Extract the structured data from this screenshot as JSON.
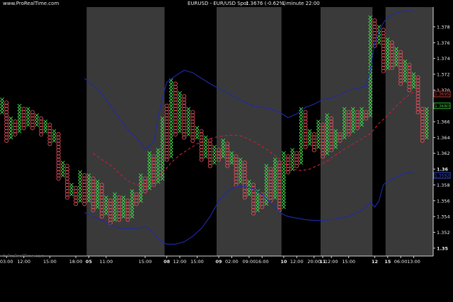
{
  "header": {
    "site": "www.ProRealTime.com",
    "instrument": "EURUSD - EUR/USD Spot",
    "price": "1.3676 (-0.62%)",
    "timeframe": "1 minute 22:00"
  },
  "watermark": "© ProRealTime.com",
  "chart_data": {
    "type": "point-and-figure",
    "ylim": [
      1.349,
      1.3805
    ],
    "y_ticks": [
      "1.35",
      "1.352",
      "1.354",
      "1.356",
      "1.358",
      "1.36",
      "1.362",
      "1.364",
      "1.366",
      "1.368",
      "1.370",
      "1.372",
      "1.374",
      "1.376",
      "1.378"
    ],
    "y_tick_values": [
      1.35,
      1.352,
      1.354,
      1.356,
      1.358,
      1.36,
      1.362,
      1.364,
      1.366,
      1.368,
      1.37,
      1.372,
      1.374,
      1.376,
      1.378
    ],
    "box_size": 0.0004,
    "n_columns": 100,
    "x_labels": [
      {
        "text": "03:00",
        "col": 1,
        "bold": false
      },
      {
        "text": "12:00",
        "col": 5,
        "bold": false
      },
      {
        "text": "15:00",
        "col": 11,
        "bold": false
      },
      {
        "text": "18:00",
        "col": 17,
        "bold": false
      },
      {
        "text": "05",
        "col": 20,
        "bold": true
      },
      {
        "text": "11:00",
        "col": 24,
        "bold": false
      },
      {
        "text": "15:00",
        "col": 33,
        "bold": false
      },
      {
        "text": "08",
        "col": 38,
        "bold": true
      },
      {
        "text": "12:00",
        "col": 41,
        "bold": false
      },
      {
        "text": "15:00",
        "col": 45,
        "bold": false
      },
      {
        "text": "09",
        "col": 50,
        "bold": true
      },
      {
        "text": "02:00",
        "col": 53,
        "bold": false
      },
      {
        "text": "09:00",
        "col": 57,
        "bold": false
      },
      {
        "text": "16:00",
        "col": 60,
        "bold": false
      },
      {
        "text": "10",
        "col": 65,
        "bold": true
      },
      {
        "text": "12:00",
        "col": 68,
        "bold": false
      },
      {
        "text": "20:00",
        "col": 72,
        "bold": false
      },
      {
        "text": "11",
        "col": 74,
        "bold": true
      },
      {
        "text": "12:00",
        "col": 76,
        "bold": false
      },
      {
        "text": "15:00",
        "col": 80,
        "bold": false
      },
      {
        "text": "12",
        "col": 86,
        "bold": true
      },
      {
        "text": "15",
        "col": 89,
        "bold": true
      },
      {
        "text": "06:00",
        "col": 92,
        "bold": false
      },
      {
        "text": "13:00",
        "col": 95,
        "bold": false
      }
    ],
    "bands": [
      {
        "from": 0,
        "to": 20,
        "shade": "dark"
      },
      {
        "from": 20,
        "to": 38,
        "shade": "light"
      },
      {
        "from": 38,
        "to": 50,
        "shade": "dark"
      },
      {
        "from": 50,
        "to": 65,
        "shade": "light"
      },
      {
        "from": 65,
        "to": 74,
        "shade": "dark"
      },
      {
        "from": 74,
        "to": 86,
        "shade": "light"
      },
      {
        "from": 86,
        "to": 89,
        "shade": "dark"
      },
      {
        "from": 89,
        "to": 100,
        "shade": "light"
      }
    ],
    "columns": [
      {
        "t": "X",
        "low": 1.3672,
        "high": 1.3688
      },
      {
        "t": "O",
        "low": 1.3636,
        "high": 1.3684
      },
      {
        "t": "X",
        "low": 1.364,
        "high": 1.3664
      },
      {
        "t": "O",
        "low": 1.3644,
        "high": 1.366
      },
      {
        "t": "X",
        "low": 1.3648,
        "high": 1.368
      },
      {
        "t": "O",
        "low": 1.3652,
        "high": 1.3676
      },
      {
        "t": "X",
        "low": 1.3656,
        "high": 1.3676
      },
      {
        "t": "O",
        "low": 1.3652,
        "high": 1.3672
      },
      {
        "t": "X",
        "low": 1.3656,
        "high": 1.3668
      },
      {
        "t": "O",
        "low": 1.3644,
        "high": 1.3664
      },
      {
        "t": "X",
        "low": 1.3648,
        "high": 1.366
      },
      {
        "t": "O",
        "low": 1.3632,
        "high": 1.3656
      },
      {
        "t": "X",
        "low": 1.3636,
        "high": 1.3648
      },
      {
        "t": "O",
        "low": 1.3588,
        "high": 1.3644
      },
      {
        "t": "X",
        "low": 1.3592,
        "high": 1.3608
      },
      {
        "t": "O",
        "low": 1.3564,
        "high": 1.3604
      },
      {
        "t": "X",
        "low": 1.3568,
        "high": 1.358
      },
      {
        "t": "O",
        "low": 1.3556,
        "high": 1.3576
      },
      {
        "t": "X",
        "low": 1.356,
        "high": 1.3596
      },
      {
        "t": "O",
        "low": 1.3556,
        "high": 1.3592
      },
      {
        "t": "X",
        "low": 1.356,
        "high": 1.3592
      },
      {
        "t": "O",
        "low": 1.3548,
        "high": 1.3588
      },
      {
        "t": "X",
        "low": 1.3552,
        "high": 1.3584
      },
      {
        "t": "O",
        "low": 1.354,
        "high": 1.358
      },
      {
        "t": "X",
        "low": 1.3544,
        "high": 1.3564
      },
      {
        "t": "O",
        "low": 1.3532,
        "high": 1.356
      },
      {
        "t": "X",
        "low": 1.3536,
        "high": 1.3568
      },
      {
        "t": "O",
        "low": 1.3536,
        "high": 1.3564
      },
      {
        "t": "X",
        "low": 1.354,
        "high": 1.3564
      },
      {
        "t": "O",
        "low": 1.3536,
        "high": 1.356
      },
      {
        "t": "X",
        "low": 1.354,
        "high": 1.3572
      },
      {
        "t": "O",
        "low": 1.3556,
        "high": 1.3568
      },
      {
        "t": "X",
        "low": 1.356,
        "high": 1.3592
      },
      {
        "t": "O",
        "low": 1.3572,
        "high": 1.3588
      },
      {
        "t": "X",
        "low": 1.3576,
        "high": 1.362
      },
      {
        "t": "O",
        "low": 1.358,
        "high": 1.3616
      },
      {
        "t": "X",
        "low": 1.3584,
        "high": 1.3624
      },
      {
        "t": "X",
        "low": 1.3588,
        "high": 1.3664
      },
      {
        "t": "O",
        "low": 1.3612,
        "high": 1.368
      },
      {
        "t": "X",
        "low": 1.3616,
        "high": 1.3712
      },
      {
        "t": "O",
        "low": 1.3644,
        "high": 1.3708
      },
      {
        "t": "X",
        "low": 1.3648,
        "high": 1.3696
      },
      {
        "t": "O",
        "low": 1.364,
        "high": 1.3692
      },
      {
        "t": "X",
        "low": 1.3644,
        "high": 1.3676
      },
      {
        "t": "O",
        "low": 1.3636,
        "high": 1.3672
      },
      {
        "t": "X",
        "low": 1.364,
        "high": 1.3652
      },
      {
        "t": "O",
        "low": 1.3612,
        "high": 1.3648
      },
      {
        "t": "X",
        "low": 1.3616,
        "high": 1.364
      },
      {
        "t": "O",
        "low": 1.3604,
        "high": 1.3636
      },
      {
        "t": "X",
        "low": 1.3608,
        "high": 1.3628
      },
      {
        "t": "O",
        "low": 1.3612,
        "high": 1.3624
      },
      {
        "t": "X",
        "low": 1.3616,
        "high": 1.3636
      },
      {
        "t": "O",
        "low": 1.3604,
        "high": 1.3632
      },
      {
        "t": "X",
        "low": 1.3608,
        "high": 1.362
      },
      {
        "t": "O",
        "low": 1.358,
        "high": 1.3616
      },
      {
        "t": "X",
        "low": 1.3584,
        "high": 1.3612
      },
      {
        "t": "O",
        "low": 1.3564,
        "high": 1.3608
      },
      {
        "t": "X",
        "low": 1.3568,
        "high": 1.3584
      },
      {
        "t": "O",
        "low": 1.3544,
        "high": 1.358
      },
      {
        "t": "X",
        "low": 1.3548,
        "high": 1.3572
      },
      {
        "t": "O",
        "low": 1.3552,
        "high": 1.3568
      },
      {
        "t": "X",
        "low": 1.3556,
        "high": 1.3604
      },
      {
        "t": "O",
        "low": 1.356,
        "high": 1.36
      },
      {
        "t": "X",
        "low": 1.3564,
        "high": 1.3612
      },
      {
        "t": "O",
        "low": 1.3548,
        "high": 1.3608
      },
      {
        "t": "X",
        "low": 1.3552,
        "high": 1.362
      },
      {
        "t": "O",
        "low": 1.3596,
        "high": 1.3616
      },
      {
        "t": "X",
        "low": 1.36,
        "high": 1.3624
      },
      {
        "t": "O",
        "low": 1.3604,
        "high": 1.362
      },
      {
        "t": "X",
        "low": 1.3608,
        "high": 1.3676
      },
      {
        "t": "O",
        "low": 1.3628,
        "high": 1.3672
      },
      {
        "t": "X",
        "low": 1.3632,
        "high": 1.3648
      },
      {
        "t": "O",
        "low": 1.3624,
        "high": 1.3644
      },
      {
        "t": "X",
        "low": 1.3628,
        "high": 1.366
      },
      {
        "t": "O",
        "low": 1.3616,
        "high": 1.3656
      },
      {
        "t": "X",
        "low": 1.362,
        "high": 1.3668
      },
      {
        "t": "O",
        "low": 1.3624,
        "high": 1.3664
      },
      {
        "t": "X",
        "low": 1.3628,
        "high": 1.3648
      },
      {
        "t": "O",
        "low": 1.3636,
        "high": 1.3644
      },
      {
        "t": "X",
        "low": 1.364,
        "high": 1.3676
      },
      {
        "t": "O",
        "low": 1.3644,
        "high": 1.3672
      },
      {
        "t": "X",
        "low": 1.3648,
        "high": 1.3676
      },
      {
        "t": "O",
        "low": 1.3652,
        "high": 1.3672
      },
      {
        "t": "X",
        "low": 1.3656,
        "high": 1.3676
      },
      {
        "t": "O",
        "low": 1.3664,
        "high": 1.3672
      },
      {
        "t": "X",
        "low": 1.3668,
        "high": 1.3792
      },
      {
        "t": "O",
        "low": 1.3756,
        "high": 1.3788
      },
      {
        "t": "X",
        "low": 1.376,
        "high": 1.378
      },
      {
        "t": "O",
        "low": 1.3724,
        "high": 1.3776
      },
      {
        "t": "X",
        "low": 1.3728,
        "high": 1.3764
      },
      {
        "t": "O",
        "low": 1.3728,
        "high": 1.376
      },
      {
        "t": "X",
        "low": 1.3732,
        "high": 1.3752
      },
      {
        "t": "O",
        "low": 1.3708,
        "high": 1.3748
      },
      {
        "t": "X",
        "low": 1.3712,
        "high": 1.3736
      },
      {
        "t": "O",
        "low": 1.37,
        "high": 1.3732
      },
      {
        "t": "X",
        "low": 1.3704,
        "high": 1.372
      },
      {
        "t": "O",
        "low": 1.3672,
        "high": 1.3716
      },
      {
        "t": "O",
        "low": 1.3636,
        "high": 1.3676
      },
      {
        "t": "X",
        "low": 1.364,
        "high": 1.3676
      }
    ],
    "series": [
      {
        "kind": "upper-band",
        "color": "#1f2aa6",
        "points": [
          [
            19,
            1.3715
          ],
          [
            21,
            1.3705
          ],
          [
            23,
            1.3695
          ],
          [
            25,
            1.368
          ],
          [
            27,
            1.3665
          ],
          [
            29,
            1.365
          ],
          [
            31,
            1.364
          ],
          [
            33,
            1.3625
          ],
          [
            35,
            1.3635
          ],
          [
            36,
            1.3665
          ],
          [
            37,
            1.369
          ],
          [
            38,
            1.371
          ],
          [
            40,
            1.3718
          ],
          [
            42,
            1.3725
          ],
          [
            44,
            1.3722
          ],
          [
            46,
            1.3715
          ],
          [
            48,
            1.3708
          ],
          [
            50,
            1.3702
          ],
          [
            52,
            1.3697
          ],
          [
            54,
            1.369
          ],
          [
            56,
            1.3685
          ],
          [
            58,
            1.368
          ],
          [
            60,
            1.3678
          ],
          [
            62,
            1.3676
          ],
          [
            64,
            1.3672
          ],
          [
            66,
            1.3665
          ],
          [
            68,
            1.367
          ],
          [
            70,
            1.3678
          ],
          [
            72,
            1.3682
          ],
          [
            74,
            1.3688
          ],
          [
            76,
            1.369
          ],
          [
            78,
            1.3694
          ],
          [
            80,
            1.37
          ],
          [
            82,
            1.3702
          ],
          [
            84,
            1.3705
          ],
          [
            85,
            1.3725
          ],
          [
            86,
            1.376
          ],
          [
            87,
            1.3775
          ],
          [
            88,
            1.3785
          ],
          [
            89,
            1.3792
          ],
          [
            91,
            1.3798
          ],
          [
            93,
            1.38
          ],
          [
            95,
            1.38
          ]
        ]
      },
      {
        "kind": "lower-band",
        "color": "#1f2aa6",
        "points": [
          [
            19,
            1.3545
          ],
          [
            21,
            1.354
          ],
          [
            23,
            1.3535
          ],
          [
            25,
            1.353
          ],
          [
            27,
            1.3525
          ],
          [
            29,
            1.3525
          ],
          [
            31,
            1.3525
          ],
          [
            33,
            1.3527
          ],
          [
            35,
            1.352
          ],
          [
            36,
            1.3512
          ],
          [
            37,
            1.3508
          ],
          [
            38,
            1.3505
          ],
          [
            40,
            1.3505
          ],
          [
            42,
            1.3508
          ],
          [
            44,
            1.3515
          ],
          [
            46,
            1.3525
          ],
          [
            48,
            1.354
          ],
          [
            50,
            1.356
          ],
          [
            52,
            1.3572
          ],
          [
            54,
            1.3578
          ],
          [
            56,
            1.3578
          ],
          [
            58,
            1.3575
          ],
          [
            60,
            1.3568
          ],
          [
            62,
            1.3557
          ],
          [
            64,
            1.3545
          ],
          [
            66,
            1.354
          ],
          [
            68,
            1.3538
          ],
          [
            70,
            1.3536
          ],
          [
            72,
            1.3535
          ],
          [
            74,
            1.3535
          ],
          [
            76,
            1.3536
          ],
          [
            78,
            1.3538
          ],
          [
            80,
            1.354
          ],
          [
            82,
            1.3545
          ],
          [
            84,
            1.3552
          ],
          [
            85,
            1.3558
          ],
          [
            86,
            1.3552
          ],
          [
            87,
            1.356
          ],
          [
            88,
            1.358
          ],
          [
            89,
            1.3585
          ],
          [
            91,
            1.359
          ],
          [
            93,
            1.3595
          ],
          [
            95,
            1.3595
          ]
        ]
      },
      {
        "kind": "moving-average",
        "color": "#c0203a",
        "dashed": true,
        "points": [
          [
            21,
            1.362
          ],
          [
            23,
            1.3612
          ],
          [
            25,
            1.3605
          ],
          [
            27,
            1.3595
          ],
          [
            29,
            1.3585
          ],
          [
            31,
            1.358
          ],
          [
            33,
            1.358
          ],
          [
            35,
            1.3585
          ],
          [
            37,
            1.3595
          ],
          [
            39,
            1.3608
          ],
          [
            41,
            1.3618
          ],
          [
            43,
            1.3625
          ],
          [
            45,
            1.3632
          ],
          [
            47,
            1.3637
          ],
          [
            49,
            1.364
          ],
          [
            51,
            1.3642
          ],
          [
            53,
            1.3643
          ],
          [
            55,
            1.3642
          ],
          [
            57,
            1.3638
          ],
          [
            59,
            1.3632
          ],
          [
            61,
            1.3625
          ],
          [
            63,
            1.3617
          ],
          [
            65,
            1.3608
          ],
          [
            67,
            1.36
          ],
          [
            69,
            1.3598
          ],
          [
            71,
            1.36
          ],
          [
            73,
            1.3605
          ],
          [
            75,
            1.361
          ],
          [
            77,
            1.3618
          ],
          [
            79,
            1.3625
          ],
          [
            81,
            1.3632
          ],
          [
            83,
            1.3638
          ],
          [
            85,
            1.3645
          ],
          [
            87,
            1.3658
          ],
          [
            89,
            1.3668
          ],
          [
            91,
            1.368
          ],
          [
            93,
            1.369
          ],
          [
            95,
            1.3698
          ]
        ]
      }
    ],
    "price_markers": [
      {
        "text": "1.3695",
        "value": 1.3695,
        "color": "#d23a3a",
        "outline": "#e04848"
      },
      {
        "text": "1.3680",
        "value": 1.368,
        "color": "#36c236",
        "outline": "#3ed23e"
      },
      {
        "text": "1.3592",
        "value": 1.3592,
        "color": "#3a48d8",
        "outline": "#3f59e0"
      }
    ],
    "colors": {
      "x_mark": "#3fd34a",
      "o_mark": "#e2515c",
      "band_dark": "#000000",
      "band_light": "#3a3a3a",
      "axis": "#cfcfcf"
    }
  }
}
